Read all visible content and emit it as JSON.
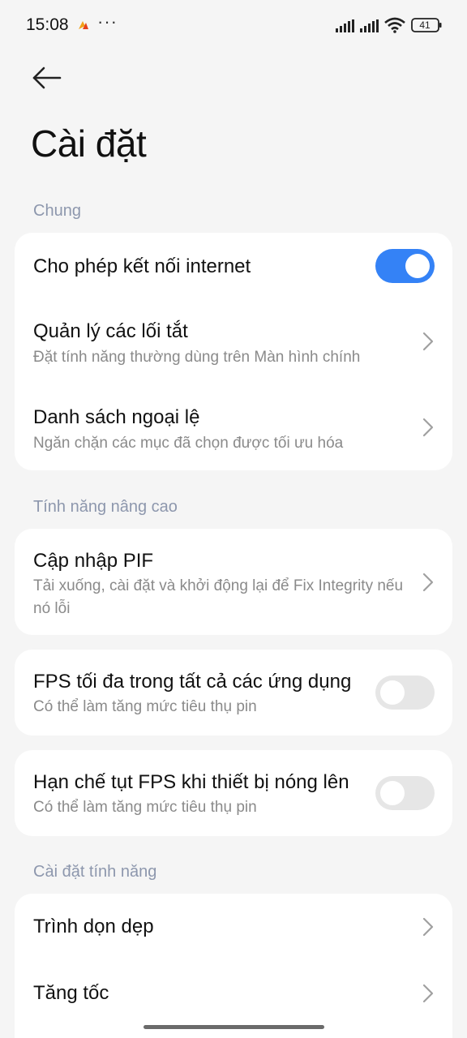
{
  "status_bar": {
    "time": "15:08",
    "dots": "···",
    "battery": "41"
  },
  "header": {
    "title": "Cài đặt"
  },
  "sections": {
    "general": {
      "label": "Chung",
      "items": {
        "allow_internet": {
          "title": "Cho phép kết nối internet",
          "toggle_on": true
        },
        "shortcuts": {
          "title": "Quản lý các lối tắt",
          "subtitle": "Đặt tính năng thường dùng trên Màn hình chính"
        },
        "exceptions": {
          "title": "Danh sách ngoại lệ",
          "subtitle": "Ngăn chặn các mục đã chọn được tối ưu hóa"
        }
      }
    },
    "advanced": {
      "label": "Tính năng nâng cao",
      "items": {
        "update_pif": {
          "title": "Cập nhập PIF",
          "subtitle": "Tải xuống, cài đặt và khởi động lại để Fix Integrity nếu nó lỗi"
        },
        "max_fps": {
          "title": "FPS tối đa trong tất cả các ứng dụng",
          "subtitle": "Có thể làm tăng mức tiêu thụ pin",
          "toggle_on": false
        },
        "limit_fps_drop": {
          "title": "Hạn chế tụt FPS khi thiết bị nóng lên",
          "subtitle": "Có thể làm tăng mức tiêu thụ pin",
          "toggle_on": false
        }
      }
    },
    "features": {
      "label": "Cài đặt tính năng",
      "items": {
        "cleaner": {
          "title": "Trình dọn dẹp"
        },
        "booster": {
          "title": "Tăng tốc"
        }
      }
    }
  },
  "colors": {
    "accent": "#3482f6",
    "section_label": "#8d97ad",
    "background": "#f5f5f5",
    "card": "#ffffff"
  }
}
